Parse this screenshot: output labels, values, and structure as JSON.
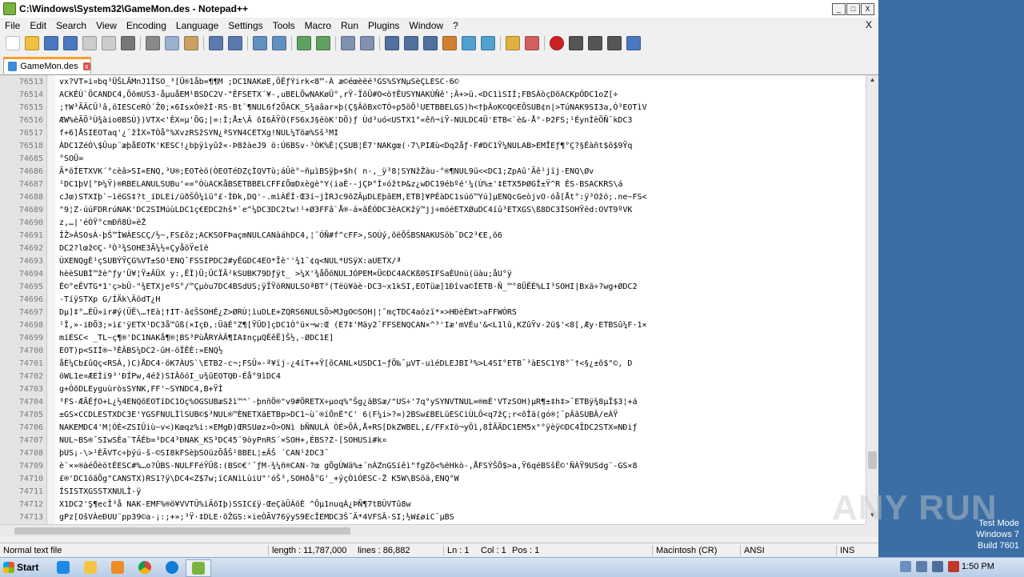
{
  "window": {
    "title": "C:\\Windows\\System32\\GameMon.des - Notepad++",
    "controls": {
      "minimize": "_",
      "maximize": "□",
      "close": "X"
    }
  },
  "menubar": {
    "items": [
      "File",
      "Edit",
      "Search",
      "View",
      "Encoding",
      "Language",
      "Settings",
      "Tools",
      "Macro",
      "Run",
      "Plugins",
      "Window",
      "?"
    ],
    "close": "X"
  },
  "toolbar": {
    "icons": [
      "new-file-icon",
      "open-file-icon",
      "save-icon",
      "save-all-icon",
      "close-icon",
      "close-all-icon",
      "print-icon",
      "cut-icon",
      "copy-icon",
      "paste-icon",
      "undo-icon",
      "redo-icon",
      "find-icon",
      "replace-icon",
      "zoom-in-icon",
      "zoom-out-icon",
      "sync-v-icon",
      "sync-h-icon",
      "word-wrap-icon",
      "show-all-chars-icon",
      "indent-guide-icon",
      "language-icon",
      "doc-map-icon",
      "function-list-icon",
      "folder-workspace-icon",
      "monitoring-icon",
      "record-macro-icon",
      "stop-record-icon",
      "play-macro-icon",
      "play-multiple-icon",
      "save-macro-icon"
    ]
  },
  "tabs": [
    {
      "label": "GameMon.des",
      "close": "x"
    }
  ],
  "editor": {
    "lines": [
      {
        "num": "76513",
        "text": "vx?VT»i¤bq³ÜŠLÃMnJ1ÎSO_³[Ü®1åb=¶¶M ;DC1NAKøE,ÖËƒÝirk<8™-À æ©éœèëé³GS%SYNµSèÇLESC·6©"
      },
      {
        "num": "76514",
        "text": "ACKÉÙ`ÕCANDC4,ÕõmUS3-åµuåEM¹BSDC2V·\"ÊFSETX´¥-,uBELÕwNAKøÛ°,rŸ-ÏõÜ#O<ö†ÊUSYNAKÙÑê';Â+>ü.<DC1ìSIÍ;FBSÀòçDõACKpÓDC1oZ[÷"
      },
      {
        "num": "76515",
        "text": ";†W³ÃÄCÜ¹â,öIESCeRÒ´Ž0;×6IsxÓ®žÍ·RS·Bt¨¶NUL6f2ÕACK_S¾aâar×þ(Ç§ÂõBx©TÓ÷p5öÕ¹UETBBELGS)h<†þÂoK©Q©EÕSUB¢n|>TúNAK9SI3a,Ó³EOTìV"
      },
      {
        "num": "76516",
        "text": "ÆW%èÃÖ³Ù¾àio0BSÙ})VTX<'ÈX=µ'ÕG;|=:Ì;Å±\\Â  õI6ÂŸÒ(FS6xJ§ëòK'DÖ)ƒ Ùd³uó<USTX1°«êñ¬iŸ-NULDC4Ü'ETB<`è&-Å°-Þ2FS;¹ÉynÌèÖÑ¯kDC3"
      },
      {
        "num": "76517",
        "text": "f+6]ÅSIEOTaq'¿¨žÌX»TÒå°%XvzRSžSYN¿ªSYN4CETXg!NUL¼Tõæ%Sš³MI"
      },
      {
        "num": "76518",
        "text": "ÀDC1ZéÒ\\$Ûup¨æþåEOTK'KESC!¿bþÿìyûž«-Þ8žàeJ9    ö:Ú6BSv·³ÒK%Ê¦ÇSUB¦È7'NAKgœ(·7\\PIÆù<Dq2åƒ·F#DC1Ÿ¼NULAB>EMÎEƒ¶°Ç?§Éàñt$ô$9Ÿq"
      },
      {
        "num": "74685",
        "text": "°SOÜ="
      },
      {
        "num": "74686",
        "text": "Ã*öÍETXVK´°cèâ>SI«ENQ,³U®;EOTèö(ÒEOTéDZçÌQVTù;áÛè°~ñµìBSÿþ+$h( n-,_ÿ³8¦SYNžŽàu-°®¶NUL9ü<<DC1;ZpAû'Ãê¹jïj-ENQ\\Øv"
      },
      {
        "num": "74687",
        "text": "¹DC1þV[°Þ¼Ÿ)®RBELANULSUBu'«=°ÒùACKåBSETBBELCFF£ÕœDxègè\"Y(iaÈ·-jÇÞ°Ì¤óžtÞ&z¿wDC19ébºé'¼(Ù%±'‡ETX5ÞØGÍ±Ÿ^R   ÈS-BSACKRS\\á"
      },
      {
        "num": "74688",
        "text": "cJœ)STXIþ`~ìëGS‡?t_íDLEi/üðŠÔ¼ìü°£·ÌÐk,DQ'-.mìÀÉÍ·Œ3í~jÌRJc9õZÂµDLEþâEM,ETB]¥PÈàDC1súö™Yú]µENQcGeòjvO-óå[Åt°:ÿ³Ožö;.ne~FS<"
      },
      {
        "num": "74689",
        "text": "\"9¦Z-úúFDRrúNAK'DC2SIMúùLDC1ç€EDC2hš*`e^¼DC3DC2tw!¹+Ø3FFâ`Å®-á×ãÉÓDC3ëACKžÿ™jj÷móéETXØuDC4íû³ETXGS\\ß8DC3ÎSOHŸëd:OVT9ºVK"
      },
      {
        "num": "74690",
        "text": "z,…|'éÒŸ°cmÐñ8Ú»ëŽ"
      },
      {
        "num": "74691",
        "text": "ÎŽ>ÀSOsÀ-þŠ™ÌWÀESCÇ/½~,FS£ôz;ACKSOFÞaçmNULCANàáhDC4,¦¨ÓÑ#f^cFF>,SOÚý,õëÕŠBSNAKUSöb¯DC2³€E,õ6"
      },
      {
        "num": "74692",
        "text": "DC2?lœž©Ç-³Ò³¾SOHE3Ã¼½«ÇyåöŸeîë"
      },
      {
        "num": "74693",
        "text": "ÙXENQgÈ¹çSUBÝŸÇG%VT±SO¹ENQ¯FSSIPDC2#yÊGDC4EO*Ïè''¾1¯¢q<NUL*USÿX:aUETX/ª"
      },
      {
        "num": "74694",
        "text": "hèèSUBÌ™žè^ƒy'Ü¥¦Ÿ±ÂÜX y:,ËÎ)Ü;ÜCÏÃ²kSUBK79Dƒÿt_  >¼X'¾åÕõNULJÓPEM×Ü©DC4ACKß0SIFSaÈUnù(üàu;åU°ÿ"
      },
      {
        "num": "74695",
        "text": "É©°eËVTG*1'ç>bÛ-\"¾ETXjeºS°/™Çµòu7DC4BSdUS;ÿÏŸöRNULSOªBT°(Tëü¥àè·DC3~x1kSI,EOTüæ]1Ðîva©ÍETB·Ñ_™°8ÜËÉ%LI³SOHI|Bxä÷?wg+ØDC2"
      },
      {
        "num": "74696",
        "text": "-TíÿSTXp G/ÍÄk\\ÄödT¿H"
      },
      {
        "num": "74697",
        "text": "Dµ]‡°…ÉÜ»ir#ý(ÜË\\…†Eà¦†IT·ã¢ŠSOHÉ¿Z>ØRÙ¦ìuDLE+ZQRS6NULSÕ>MJgO©SOH|¦ˆmçTDC4aózï*×>HÐèÉWt>aFFWÓRS"
      },
      {
        "num": "74698",
        "text": "¹Î,»-iÐÕ3;»i£'ÿETX¹DC3å™ûß(×IçÐ,:ÜãÉ°Z¶[ŸÜD]çDC1Ò°ü×¬w:Œ (E7‡'Mäy2¯FFSENQCAN×^³'Iæ'mVÉu'&<L1lû,KZûŸv-2ü$'<8[,Æy·ETBSû¼F·1×"
      },
      {
        "num": "74699",
        "text": "míESC< _TL~ç¶®'DC1NAKå¶®¦BS³PùÅRYÀÂ¶IA‡nçµQÈêË]Š½,-ØDC1E]"
      },
      {
        "num": "74700",
        "text": "EOT)p<SIÌ®~³ÈÄBS¼DC2-ûH-öÏÊÈ:»ENQ½"
      },
      {
        "num": "74701",
        "text": "åÈ¼Cb£ûQç<RSÀ,)C)ÅDC4·öK7ÀUS`\\ETB2-c¬;FSÛ»·ª¥ïj-¿4íT++Ÿ[ôCANL×USDC1~ƒÕ‰¯µVT-uìéDLEJBI³%>L4SI°ETB¯³àESC1Y8°¨†<§¿±õ$\"©,    D"
      },
      {
        "num": "74702",
        "text": "öWL1e¤ÆEÌi9³'ÐÍPw,4éž)SIÂõóI_u¾ûEOTQÐ-Éå°9ìDC4"
      },
      {
        "num": "74703",
        "text": "g+ÓõDLEyguùròsSYNK,FF'~SYNDC4,B+ŸÌ"
      },
      {
        "num": "74704",
        "text": "³FS-ÆÃÉƒO+L¿½4ENQõEOTïDC1Oç%OGSUBæSžì™^`-þnñÖ®\"v9#ÕRETX÷µoq%\"Šg¿äBSæ/\"US÷'7q°ySYNVTNUL=®mÈ'VTzSOH)µR¶±‡h‡>¯ETBÿ¾8µÏ$3¦+á"
      },
      {
        "num": "74705",
        "text": "±GS×CCDLESTXDC3E'YGSFNULÌlSUB©$³NUL®™ÈNETXãETBp>DC1~ù¨®ïÕnÈ\"C' 6(F¼i>?=)2BSw£BELüESCìÙLÔ<q7žÇ;r<õÎä(gó®¦¯pÄãSUBÂ/eÀŸ"
      },
      {
        "num": "74706",
        "text": "NAKEMDC4'M¦ÒÈ<ZSIÛiù~v<)Kœqz%i:×EMgÐ)ŒRSUøz»Ò>ONì bÑNULÀ ÒÉ>ÕÂ,Å+RS[DkZWBEL,£/FFxIö¬yÖì,8ÎÃÄDC1EM5x\"°ÿèÿ©DC4ÏDC2STX=NÐiƒ"
      },
      {
        "num": "74707",
        "text": "NUL~BS®¯SIwSÈa¨TÃÉb=³DC4³ÐNAK_KS³DC45¨9òyPnRS´×SOH+,ÉBS?Z-[SOHUSi#k¤"
      },
      {
        "num": "74708",
        "text": "þUS¡-\\>¹ÈÃVTc÷þýú-š-©SI8kFSèþSOüzÕåŠ¹8BEL¦±ÂŠ ´CAN¹žDC3¯"
      },
      {
        "num": "74709",
        "text": "è¨×»®àéÕèötÉESC#%…o?ÛBS-NULFFéŸÜß:(BS©€'¯ƒM-¾¼ñ®CAN-?œ gÕgÙWä%±´nÀZnGSíêì\"fgZõ<%ëHkò-,ÅFSÝŠÕ$>a,Ÿ6qéBSšË©'ÑÀŸ9USdg¨-GS×8"
      },
      {
        "num": "74710",
        "text": "£®'DC1õãÕg\"CANSTX)RS1?ÿ\\DC4<Z$7w;ïCANìLùiU\"'óŠ³,SOHðå°G'_+ýçÒìÓESC-Ž K5W\\BSöä,ENQ°W"
      },
      {
        "num": "74711",
        "text": "ÍSISTXGSSTXNULÎ-ÿ"
      },
      {
        "num": "74712",
        "text": "X1DC2'Ş¶ecÎ³å  NAK-EMF%®ö¥VVTÛ%iÄõIþ)SSIC£ÿ-ŒeÇàÜÀöÈ  ^Õµ1nuqÀ¿ÞÑ¶7tBÛVTû8w"
      },
      {
        "num": "74713",
        "text": "gPz[OšVÀeÐUU¨pp39©a-¡:;+»;³Ÿ·‡DLE·õŽGS:×ieÒÃV76ÿyS9EcÎEMDC3Š¯Ä*4VFSÂ-SI;½W£øiC¯µBS"
      }
    ]
  },
  "statusbar": {
    "filetype": "Normal text file",
    "length": "length : 11,787,000",
    "lines": "lines : 86,882",
    "ln": "Ln : 1",
    "col": "Col : 1",
    "pos": "Pos : 1",
    "eol": "Macintosh (CR)",
    "encoding": "ANSI",
    "mode": "INS"
  },
  "desktop": {
    "testmode_line1": "Test Mode",
    "testmode_line2": "Windows 7",
    "testmode_line3": "Build 7601",
    "watermark": "ANY RUN"
  },
  "taskbar": {
    "start_label": "Start",
    "pinned": [
      "ie-icon",
      "explorer-icon",
      "media-player-icon",
      "chrome-icon",
      "edge-icon",
      "notepadpp-icon"
    ],
    "time": "1:50 PM"
  }
}
